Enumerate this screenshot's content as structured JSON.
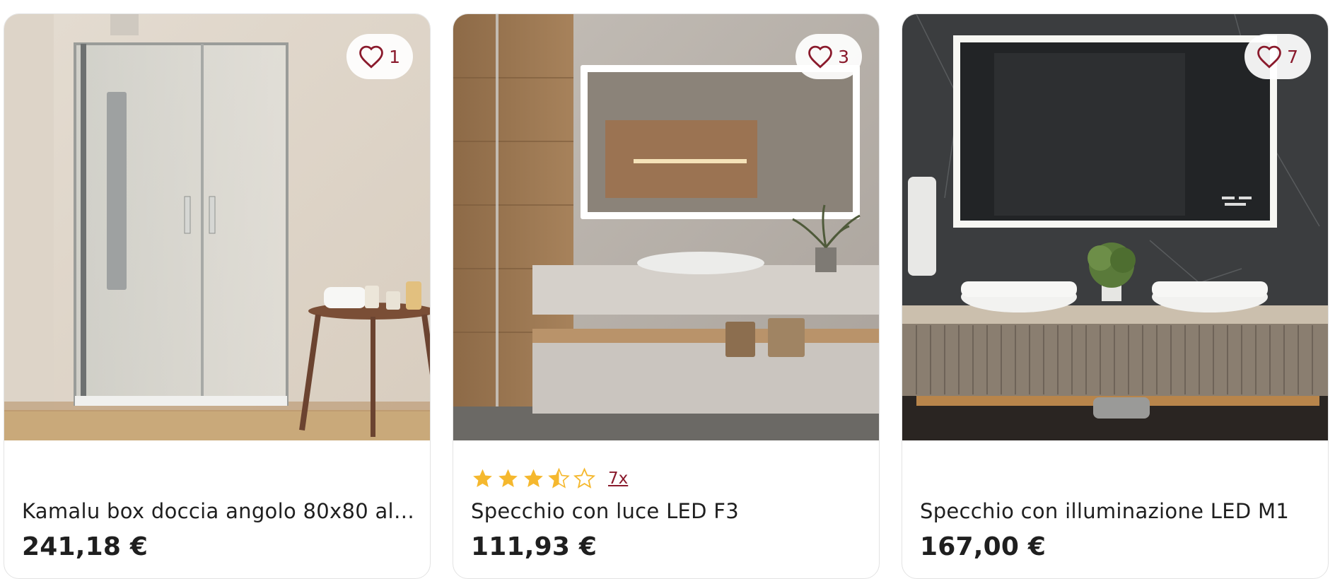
{
  "products": [
    {
      "title": "Kamalu box doccia angolo 80x80 alt...",
      "price": "241,18 €",
      "favorites": "1",
      "image_alt": "Box doccia angolare in vetro"
    },
    {
      "title": "Specchio con luce LED F3",
      "price": "111,93 €",
      "favorites": "3",
      "rating_value": 3.5,
      "rating_max": 5,
      "reviews": "7x",
      "image_alt": "Specchio retroilluminato LED"
    },
    {
      "title": "Specchio con illuminazione LED M1",
      "price": "167,00 €",
      "favorites": "7",
      "image_alt": "Specchio con cornice LED"
    }
  ],
  "colors": {
    "accent": "#8a1a2c",
    "star": "#f5b82e",
    "price": "#1f1f1f"
  },
  "icons": {
    "favorite": "heart-outline-icon",
    "rating_full": "star-filled-icon",
    "rating_half": "star-half-icon",
    "rating_empty": "star-outline-icon"
  }
}
